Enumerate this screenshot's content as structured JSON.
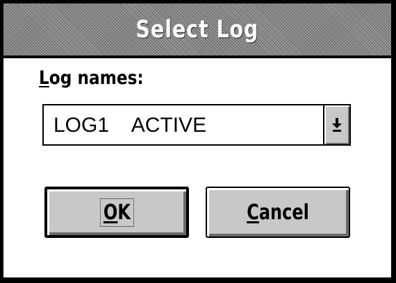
{
  "dialog": {
    "title": "Select Log",
    "field_label_prefix": "L",
    "field_label_rest": "og names:",
    "combo_value": "LOG1    ACTIVE",
    "dropdown_icon": "down-arrow-icon",
    "ok": {
      "mnemonic": "O",
      "rest": "K"
    },
    "cancel": {
      "mnemonic": "C",
      "rest": "ancel"
    }
  },
  "colors": {
    "title_bar": "#8e8e8e",
    "button_face": "#c8c8c8",
    "background": "#ffffff",
    "text": "#000000"
  }
}
